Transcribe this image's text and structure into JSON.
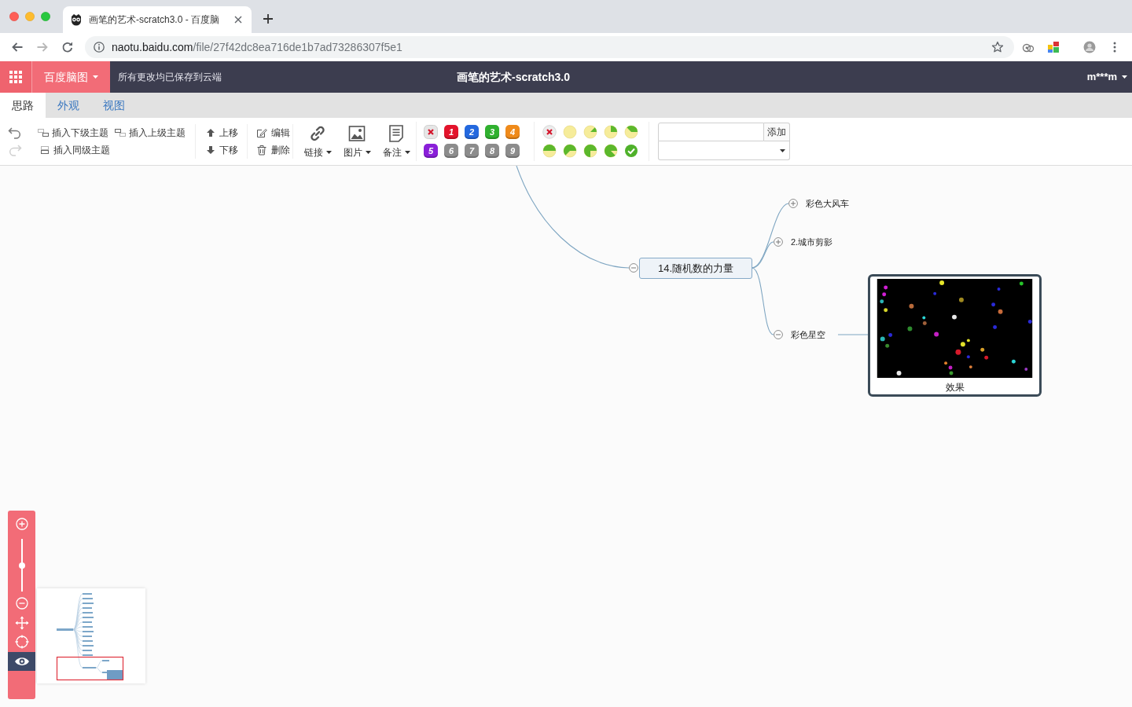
{
  "browser": {
    "tab_title": "画笔的艺术-scratch3.0 - 百度脑",
    "nav": [
      {
        "kind": "back",
        "disabled": false
      },
      {
        "kind": "forward",
        "disabled": true
      },
      {
        "kind": "reload",
        "disabled": false
      }
    ],
    "address": {
      "host": "naotu.baidu.com",
      "path": "/file/27f42dc8ea716de1b7ad73286307f5e1"
    }
  },
  "app_bar": {
    "brand": "百度脑图",
    "save_status": "所有更改均已保存到云端",
    "title": "画笔的艺术-scratch3.0",
    "user": "m***m"
  },
  "tabs": [
    {
      "label": "思路",
      "selected": true
    },
    {
      "label": "外观",
      "selected": false
    },
    {
      "label": "视图",
      "selected": false
    }
  ],
  "toolbar": {
    "history": [
      {
        "kind": "undo",
        "disabled": false
      },
      {
        "kind": "redo",
        "disabled": true
      }
    ],
    "insert": [
      {
        "kind": "child",
        "label": "插入下级主题"
      },
      {
        "kind": "parent",
        "label": "插入上级主题"
      },
      {
        "kind": "sibling",
        "label": "插入同级主题"
      }
    ],
    "move": [
      {
        "kind": "up",
        "label": "上移"
      },
      {
        "kind": "down",
        "label": "下移"
      }
    ],
    "edit": [
      {
        "kind": "edit",
        "label": "编辑"
      },
      {
        "kind": "delete",
        "label": "删除"
      }
    ],
    "menus": [
      {
        "kind": "link",
        "label": "链接"
      },
      {
        "kind": "image",
        "label": "图片"
      },
      {
        "kind": "note",
        "label": "备注"
      }
    ],
    "priority": [
      {
        "kind": "clear"
      },
      {
        "kind": "number",
        "label": "1",
        "color": "#e3132b"
      },
      {
        "kind": "number",
        "label": "2",
        "color": "#2368de"
      },
      {
        "kind": "number",
        "label": "3",
        "color": "#30b12f"
      },
      {
        "kind": "number",
        "label": "4",
        "color": "#ef8a1a"
      },
      {
        "kind": "number",
        "label": "5",
        "color": "#8a1fd9"
      },
      {
        "kind": "number",
        "label": "6",
        "color": "#8c8c8c"
      },
      {
        "kind": "number",
        "label": "7",
        "color": "#8c8c8c"
      },
      {
        "kind": "number",
        "label": "8",
        "color": "#8c8c8c"
      },
      {
        "kind": "number",
        "label": "9",
        "color": "#8c8c8c"
      }
    ],
    "progress": [
      {
        "kind": "clear"
      },
      {
        "kind": "pie"
      },
      {
        "kind": "pie"
      },
      {
        "kind": "pie"
      },
      {
        "kind": "pie"
      },
      {
        "kind": "pie"
      },
      {
        "kind": "pie"
      },
      {
        "kind": "pie"
      },
      {
        "kind": "pie"
      },
      {
        "kind": "done"
      }
    ],
    "tag": {
      "button": "添加"
    }
  },
  "mindmap": {
    "topic": {
      "text": "14.随机数的力量",
      "expanded": true,
      "selected": false,
      "children": [
        {
          "kind": "text",
          "text": "彩色大风车",
          "expanded": false,
          "selected": false
        },
        {
          "kind": "text",
          "text": "2.城市剪影",
          "expanded": false,
          "selected": false
        },
        {
          "kind": "text",
          "text": "彩色星空",
          "expanded": true,
          "selected": false,
          "children": [
            {
              "kind": "image",
              "caption": "效果",
              "selected": true
            }
          ]
        }
      ]
    }
  },
  "zoom_panel": {
    "level": 0.5,
    "minimap_shown": true
  }
}
